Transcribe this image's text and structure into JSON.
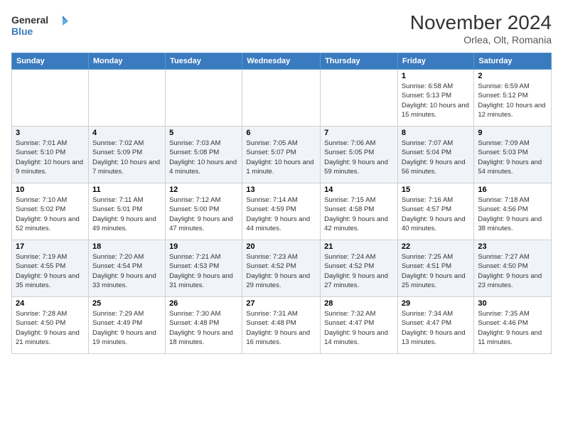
{
  "header": {
    "logo_line1": "General",
    "logo_line2": "Blue",
    "month_title": "November 2024",
    "subtitle": "Orlea, Olt, Romania"
  },
  "weekdays": [
    "Sunday",
    "Monday",
    "Tuesday",
    "Wednesday",
    "Thursday",
    "Friday",
    "Saturday"
  ],
  "weeks": [
    [
      {
        "day": "",
        "detail": ""
      },
      {
        "day": "",
        "detail": ""
      },
      {
        "day": "",
        "detail": ""
      },
      {
        "day": "",
        "detail": ""
      },
      {
        "day": "",
        "detail": ""
      },
      {
        "day": "1",
        "detail": "Sunrise: 6:58 AM\nSunset: 5:13 PM\nDaylight: 10 hours and 15 minutes."
      },
      {
        "day": "2",
        "detail": "Sunrise: 6:59 AM\nSunset: 5:12 PM\nDaylight: 10 hours and 12 minutes."
      }
    ],
    [
      {
        "day": "3",
        "detail": "Sunrise: 7:01 AM\nSunset: 5:10 PM\nDaylight: 10 hours and 9 minutes."
      },
      {
        "day": "4",
        "detail": "Sunrise: 7:02 AM\nSunset: 5:09 PM\nDaylight: 10 hours and 7 minutes."
      },
      {
        "day": "5",
        "detail": "Sunrise: 7:03 AM\nSunset: 5:08 PM\nDaylight: 10 hours and 4 minutes."
      },
      {
        "day": "6",
        "detail": "Sunrise: 7:05 AM\nSunset: 5:07 PM\nDaylight: 10 hours and 1 minute."
      },
      {
        "day": "7",
        "detail": "Sunrise: 7:06 AM\nSunset: 5:05 PM\nDaylight: 9 hours and 59 minutes."
      },
      {
        "day": "8",
        "detail": "Sunrise: 7:07 AM\nSunset: 5:04 PM\nDaylight: 9 hours and 56 minutes."
      },
      {
        "day": "9",
        "detail": "Sunrise: 7:09 AM\nSunset: 5:03 PM\nDaylight: 9 hours and 54 minutes."
      }
    ],
    [
      {
        "day": "10",
        "detail": "Sunrise: 7:10 AM\nSunset: 5:02 PM\nDaylight: 9 hours and 52 minutes."
      },
      {
        "day": "11",
        "detail": "Sunrise: 7:11 AM\nSunset: 5:01 PM\nDaylight: 9 hours and 49 minutes."
      },
      {
        "day": "12",
        "detail": "Sunrise: 7:12 AM\nSunset: 5:00 PM\nDaylight: 9 hours and 47 minutes."
      },
      {
        "day": "13",
        "detail": "Sunrise: 7:14 AM\nSunset: 4:59 PM\nDaylight: 9 hours and 44 minutes."
      },
      {
        "day": "14",
        "detail": "Sunrise: 7:15 AM\nSunset: 4:58 PM\nDaylight: 9 hours and 42 minutes."
      },
      {
        "day": "15",
        "detail": "Sunrise: 7:16 AM\nSunset: 4:57 PM\nDaylight: 9 hours and 40 minutes."
      },
      {
        "day": "16",
        "detail": "Sunrise: 7:18 AM\nSunset: 4:56 PM\nDaylight: 9 hours and 38 minutes."
      }
    ],
    [
      {
        "day": "17",
        "detail": "Sunrise: 7:19 AM\nSunset: 4:55 PM\nDaylight: 9 hours and 35 minutes."
      },
      {
        "day": "18",
        "detail": "Sunrise: 7:20 AM\nSunset: 4:54 PM\nDaylight: 9 hours and 33 minutes."
      },
      {
        "day": "19",
        "detail": "Sunrise: 7:21 AM\nSunset: 4:53 PM\nDaylight: 9 hours and 31 minutes."
      },
      {
        "day": "20",
        "detail": "Sunrise: 7:23 AM\nSunset: 4:52 PM\nDaylight: 9 hours and 29 minutes."
      },
      {
        "day": "21",
        "detail": "Sunrise: 7:24 AM\nSunset: 4:52 PM\nDaylight: 9 hours and 27 minutes."
      },
      {
        "day": "22",
        "detail": "Sunrise: 7:25 AM\nSunset: 4:51 PM\nDaylight: 9 hours and 25 minutes."
      },
      {
        "day": "23",
        "detail": "Sunrise: 7:27 AM\nSunset: 4:50 PM\nDaylight: 9 hours and 23 minutes."
      }
    ],
    [
      {
        "day": "24",
        "detail": "Sunrise: 7:28 AM\nSunset: 4:50 PM\nDaylight: 9 hours and 21 minutes."
      },
      {
        "day": "25",
        "detail": "Sunrise: 7:29 AM\nSunset: 4:49 PM\nDaylight: 9 hours and 19 minutes."
      },
      {
        "day": "26",
        "detail": "Sunrise: 7:30 AM\nSunset: 4:48 PM\nDaylight: 9 hours and 18 minutes."
      },
      {
        "day": "27",
        "detail": "Sunrise: 7:31 AM\nSunset: 4:48 PM\nDaylight: 9 hours and 16 minutes."
      },
      {
        "day": "28",
        "detail": "Sunrise: 7:32 AM\nSunset: 4:47 PM\nDaylight: 9 hours and 14 minutes."
      },
      {
        "day": "29",
        "detail": "Sunrise: 7:34 AM\nSunset: 4:47 PM\nDaylight: 9 hours and 13 minutes."
      },
      {
        "day": "30",
        "detail": "Sunrise: 7:35 AM\nSunset: 4:46 PM\nDaylight: 9 hours and 11 minutes."
      }
    ]
  ]
}
